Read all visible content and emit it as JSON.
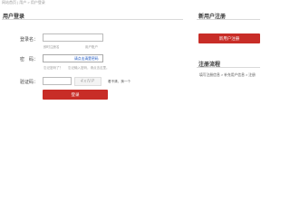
{
  "breadcrumb": "网站首页 | 用户 > 用户登录",
  "login": {
    "title": "用户登录",
    "username_label": "登录名：",
    "username_value": "",
    "username_hint_left": "即时注册名",
    "username_hint_right": "用户账户",
    "password_label": "密　码：",
    "password_inner": "请点击清楚密码",
    "password_hint_left": "忘记密码了？",
    "password_hint_right": "忘记输入密码，请点击这里。",
    "captcha_label": "验证码：",
    "captcha_value": "",
    "captcha_image_text": "4xNP",
    "refresh_text": "看不清，换一个",
    "submit_label": "登录"
  },
  "new_user": {
    "title": "新用户注册",
    "register_button": "新用户注册"
  },
  "flow": {
    "title": "注册流程",
    "steps_text": "填写注册信息 > 补充用户信息 > 注册"
  },
  "colors": {
    "accent": "#c82d27",
    "link": "#1a55c0"
  }
}
